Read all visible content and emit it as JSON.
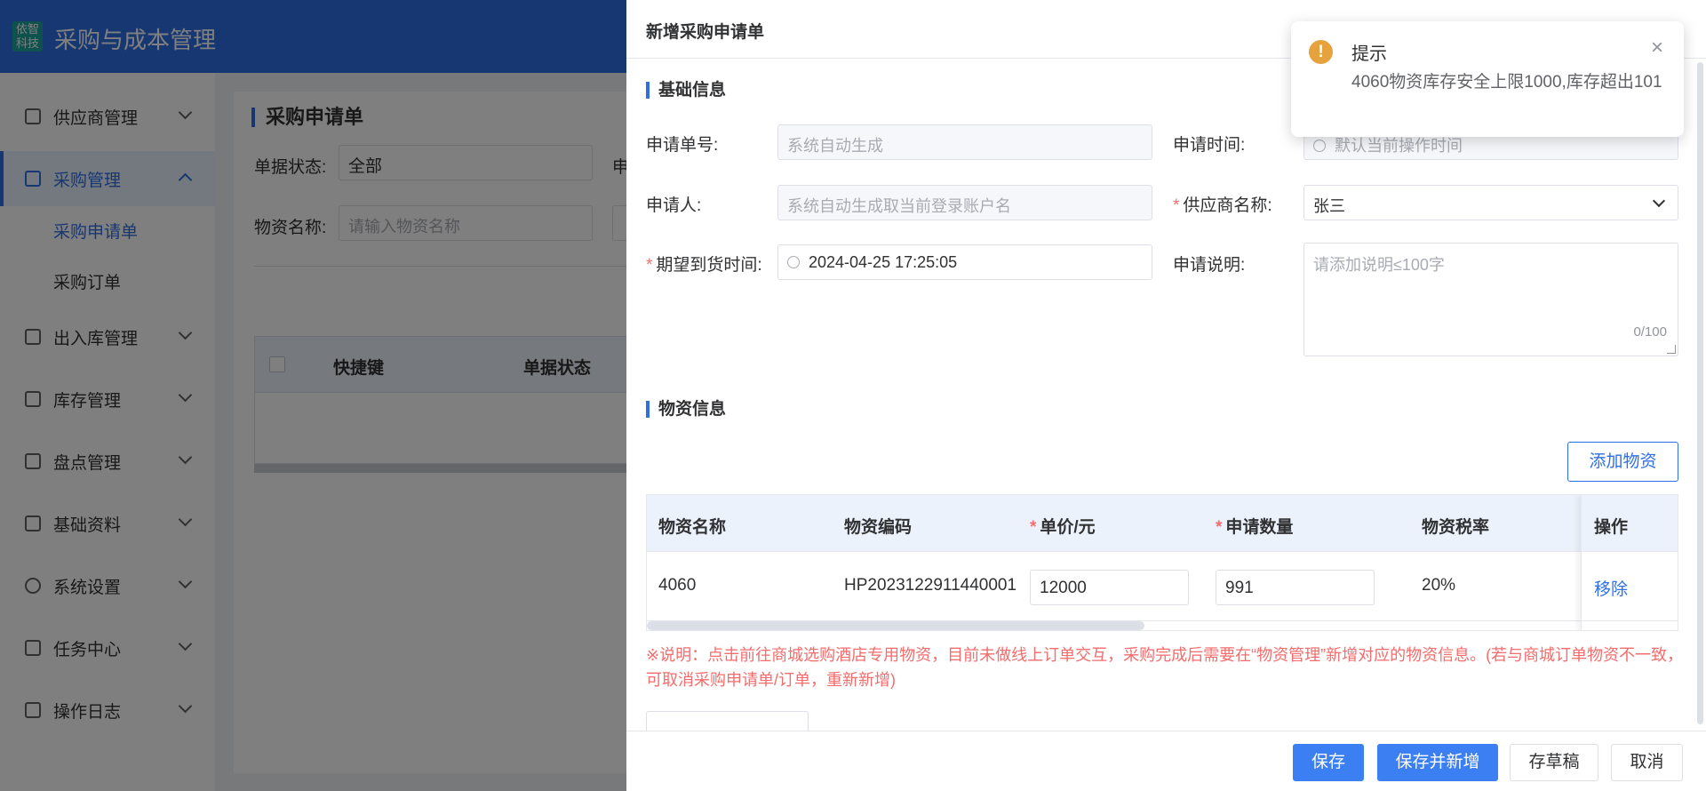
{
  "app": {
    "logo_text": "依智科技",
    "title": "采购与成本管理"
  },
  "sidebar": {
    "items": [
      {
        "label": "供应商管理",
        "icon": "supplier-icon"
      },
      {
        "label": "采购管理",
        "icon": "purchase-icon"
      },
      {
        "label": "出入库管理",
        "icon": "inout-icon"
      },
      {
        "label": "库存管理",
        "icon": "inventory-icon"
      },
      {
        "label": "盘点管理",
        "icon": "stocktake-icon"
      },
      {
        "label": "基础资料",
        "icon": "basic-data-icon"
      },
      {
        "label": "系统设置",
        "icon": "gear-icon"
      },
      {
        "label": "任务中心",
        "icon": "task-icon"
      },
      {
        "label": "操作日志",
        "icon": "log-icon"
      }
    ],
    "sub_items": [
      "采购申请单",
      "采购订单"
    ]
  },
  "page": {
    "title": "采购申请单",
    "filter_status_label": "单据状态:",
    "filter_status_value": "全部",
    "filter_partial_label": "申",
    "filter_material_label": "物资名称:",
    "filter_material_placeholder": "请输入物资名称",
    "table_headers": [
      "快捷键",
      "单据状态"
    ]
  },
  "drawer": {
    "title": "新增采购申请单",
    "basic_section": "基础信息",
    "form": {
      "order_no_label": "申请单号:",
      "order_no_placeholder": "系统自动生成",
      "apply_time_label": "申请时间:",
      "apply_time_placeholder": "默认当前操作时间",
      "applicant_label": "申请人:",
      "applicant_placeholder": "系统自动生成取当前登录账户名",
      "supplier_label": "供应商名称:",
      "supplier_value": "张三",
      "expected_time_label": "期望到货时间:",
      "expected_time_value": "2024-04-25 17:25:05",
      "remark_label": "申请说明:",
      "remark_placeholder": "请添加说明≤100字",
      "remark_count": "0/100"
    },
    "material_section": "物资信息",
    "add_material_button": "添加物资",
    "material_table": {
      "headers": {
        "name": "物资名称",
        "code": "物资编码",
        "price": "单价/元",
        "qty": "申请数量",
        "tax": "物资税率",
        "op": "操作"
      },
      "rows": [
        {
          "name": "4060",
          "code": "HP2023122911440001",
          "price": "12000",
          "qty": "991",
          "tax": "20%",
          "op": "移除"
        }
      ]
    },
    "note": "※说明：点击前往商城选购酒店专用物资，目前未做线上订单交互，采购完成后需要在“物资管理”新增对应的物资信息。(若与商城订单物资不一致，可取消采购申请单/订单，重新新增)",
    "footer": {
      "save": "保存",
      "save_new": "保存并新增",
      "draft": "存草稿",
      "cancel": "取消"
    }
  },
  "notification": {
    "title": "提示",
    "message": "4060物资库存安全上限1000,库存超出101",
    "icon": "warning-icon"
  },
  "colors": {
    "brand": "#2f6fe6",
    "danger": "#f56c6c",
    "warning": "#e6a23c"
  }
}
